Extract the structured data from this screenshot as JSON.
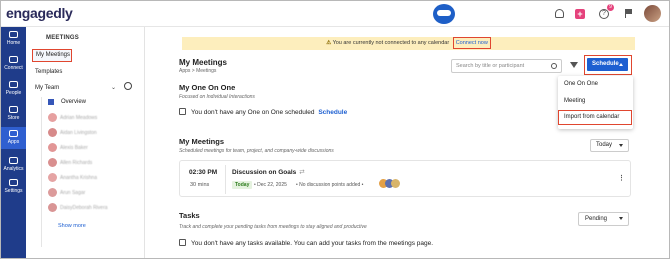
{
  "app": {
    "logo_text": "engagedly"
  },
  "topbar": {
    "notification_count": "9"
  },
  "rail": {
    "items": [
      {
        "label": "Home",
        "icon": "home-icon"
      },
      {
        "label": "Connect",
        "icon": "connect-icon"
      },
      {
        "label": "People",
        "icon": "people-icon"
      },
      {
        "label": "Store",
        "icon": "store-icon"
      },
      {
        "label": "Apps",
        "icon": "apps-icon",
        "active": true
      },
      {
        "label": "Analytics",
        "icon": "analytics-icon"
      },
      {
        "label": "Settings",
        "icon": "settings-icon"
      }
    ]
  },
  "sidebar": {
    "header": "MEETINGS",
    "my_meetings": "My Meetings",
    "templates": "Templates",
    "team_select": "My Team",
    "overview": "Overview",
    "people": [
      "Adrian Meadows",
      "Aidan Livingston",
      "Alexis Baker",
      "Allen Richards",
      "Anantha Krishna",
      "Arun Sagar",
      "DaisyDeborah Rivera"
    ],
    "show_more": "Show more"
  },
  "banner": {
    "text": "You are currently not connected to any calendar",
    "link": "Connect now"
  },
  "page": {
    "title": "My Meetings",
    "breadcrumb": "Apps  >  Meetings"
  },
  "search": {
    "placeholder": "Search by title or participant"
  },
  "schedule_button": {
    "label": "Schedule"
  },
  "dropdown": {
    "items": [
      "One On One",
      "Meeting",
      "Import from calendar"
    ]
  },
  "one_on_one": {
    "title": "My One On One",
    "subtitle": "Focused on Individual Interactions",
    "empty": "You don't have any One on One scheduled",
    "link": "Schedule"
  },
  "meetings": {
    "title": "My Meetings",
    "subtitle": "Scheduled meetings for team, project, and company-wide discussions",
    "filter": "Today",
    "card": {
      "time": "02:30 PM",
      "duration": "30 mins",
      "name": "Discussion on Goals",
      "badge": "Today",
      "date": "• Dec 22, 2025",
      "points": "• No discussion points added •"
    }
  },
  "tasks": {
    "title": "Tasks",
    "subtitle": "Track and complete your pending tasks from meetings to stay aligned and productive",
    "filter": "Pending",
    "empty": "You don't have any tasks available. You can add your tasks from the meetings page."
  },
  "colors": {
    "accent": "#1d5fd1",
    "rail": "#1f3c8a",
    "highlight": "#e0462f",
    "banner": "#fdeebd"
  }
}
